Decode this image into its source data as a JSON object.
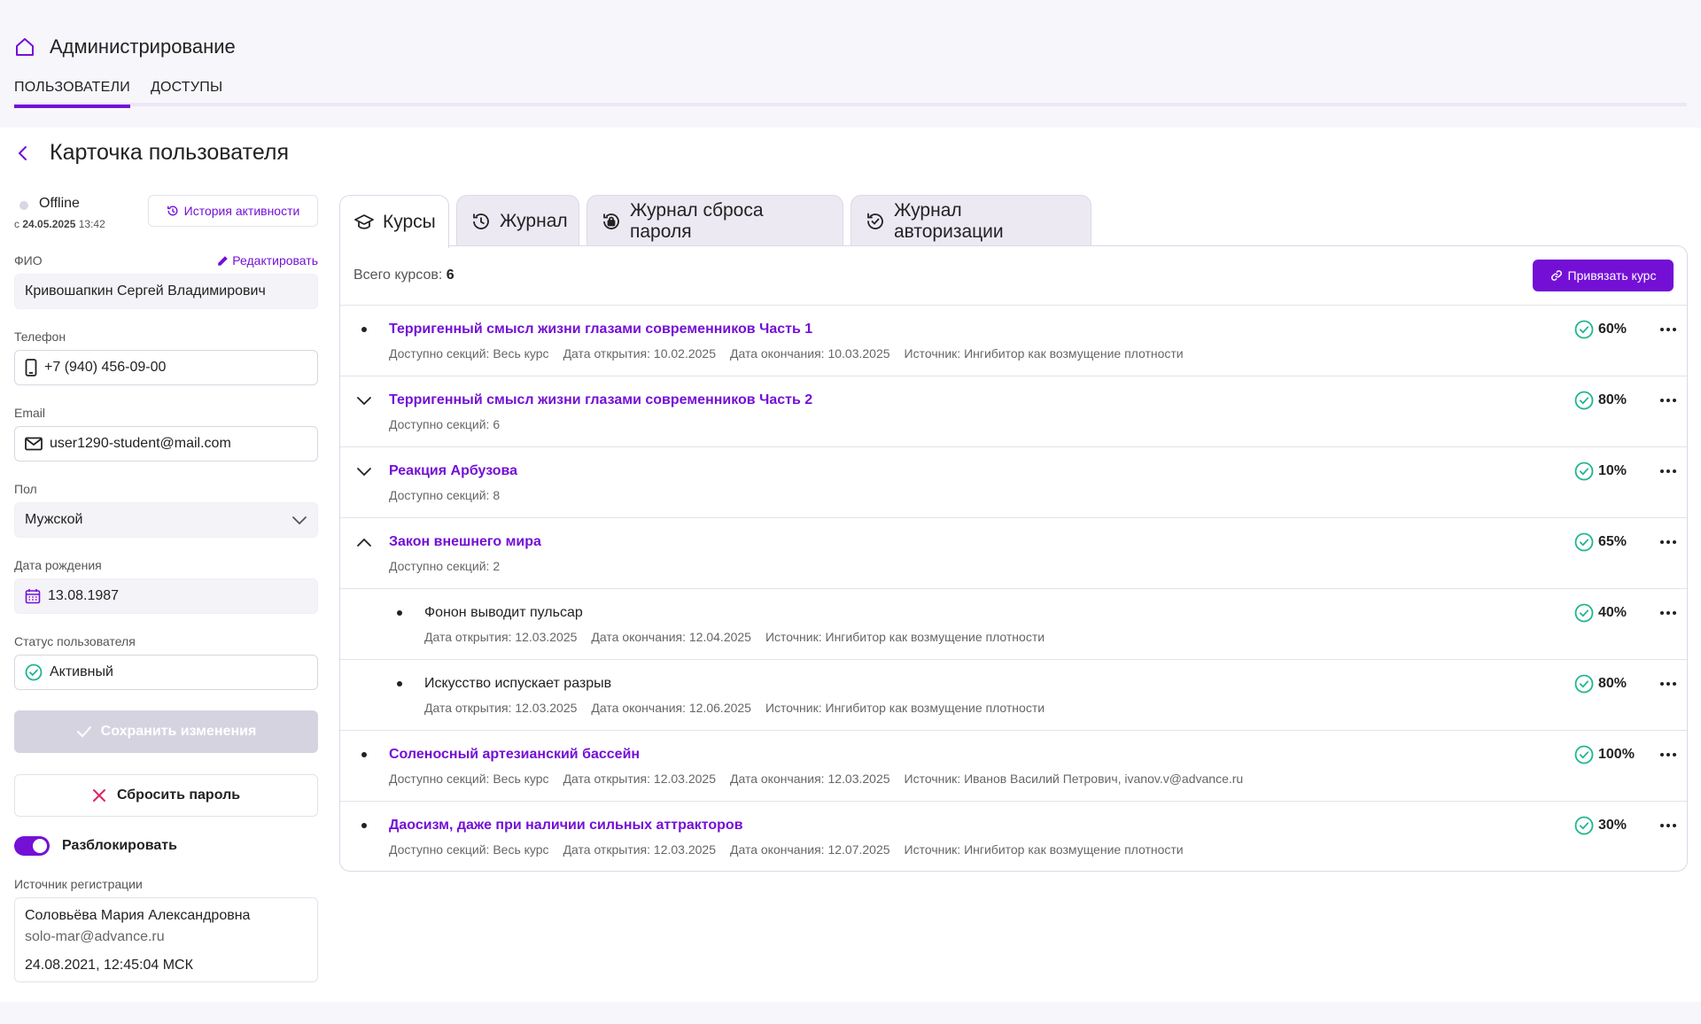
{
  "header": {
    "title": "Администрирование",
    "tabs": [
      {
        "label": "Пользователи",
        "active": true
      },
      {
        "label": "Доступы",
        "active": false
      }
    ]
  },
  "page": {
    "title": "Карточка пользователя"
  },
  "profile": {
    "status": "Offline",
    "status_since_prefix": "с",
    "status_since_date": "24.05.2025",
    "status_since_time": "13:42",
    "history_button": "История активности",
    "edit_link": "Редактировать",
    "fields": {
      "fio": {
        "label": "ФИО",
        "value": "Кривошапкин Сергей Владимирович"
      },
      "phone": {
        "label": "Телефон",
        "value": "+7 (940) 456-09-00"
      },
      "email": {
        "label": "Email",
        "value": "user1290-student@mail.com"
      },
      "gender": {
        "label": "Пол",
        "value": "Мужской"
      },
      "birth": {
        "label": "Дата рождения",
        "value": "13.08.1987"
      },
      "user_status": {
        "label": "Статус пользователя",
        "value": "Активный"
      }
    },
    "save_button": "Сохранить изменения",
    "reset_button": "Сбросить пароль",
    "unblock_label": "Разблокировать",
    "unblock_on": true,
    "reg_source": {
      "label": "Источник регистрации",
      "name": "Соловьёва Мария Александровна",
      "email": "solo-mar@advance.ru",
      "datetime": "24.08.2021, 12:45:04 МСК"
    }
  },
  "content_tabs": [
    {
      "label": "Курсы",
      "icon": "graduation-cap-icon",
      "active": true
    },
    {
      "label": "Журнал",
      "icon": "history-icon",
      "active": false
    },
    {
      "label": "Журнал сброса пароля",
      "icon": "lock-reset-icon",
      "active": false
    },
    {
      "label": "Журнал авторизации",
      "icon": "auth-history-icon",
      "active": false
    }
  ],
  "courses": {
    "total_label": "Всего курсов:",
    "total": "6",
    "bind_button": "Привязать курс",
    "rows": [
      {
        "lead": "bullet",
        "title": "Терригенный смысл жизни глазами современников Часть 1",
        "meta": [
          "Доступно секций: Весь курс",
          "Дата открытия: 10.02.2025",
          "Дата окончания: 10.03.2025",
          "Источник: Ингибитор как возмущение плотности"
        ],
        "pct": "60%"
      },
      {
        "lead": "chevron-down",
        "title": "Терригенный смысл жизни глазами современников Часть 2",
        "meta": [
          "Доступно секций:  6"
        ],
        "pct": "80%"
      },
      {
        "lead": "chevron-down",
        "title": "Реакция Арбузова",
        "meta": [
          "Доступно секций: 8"
        ],
        "pct": "10%"
      },
      {
        "lead": "chevron-up",
        "title": "Закон внешнего мира",
        "meta": [
          "Доступно секций: 2"
        ],
        "pct": "65%"
      },
      {
        "lead": "bullet",
        "child": true,
        "title": "Фонон выводит пульсар",
        "meta": [
          "Дата открытия: 12.03.2025",
          "Дата окончания: 12.04.2025",
          "Источник: Ингибитор как возмущение плотности"
        ],
        "pct": "40%"
      },
      {
        "lead": "bullet",
        "child": true,
        "title": "Искусство испускает разрыв",
        "meta": [
          "Дата открытия: 12.03.2025",
          "Дата окончания: 12.06.2025",
          "Источник: Ингибитор как возмущение плотности"
        ],
        "pct": "80%"
      },
      {
        "lead": "bullet",
        "title": "Соленосный артезианский бассейн",
        "meta": [
          "Доступно секций: Весь курс",
          "Дата открытия: 12.03.2025",
          "Дата окончания: 12.03.2025",
          "Источник: Иванов Василий Петрович, ivanov.v@advance.ru"
        ],
        "pct": "100%"
      },
      {
        "lead": "bullet",
        "title": "Даосизм, даже при наличии сильных аттракторов",
        "meta": [
          "Доступно секций: Весь курс",
          "Дата открытия: 12.03.2025",
          "Дата окончания: 12.07.2025",
          "Источник: Ингибитор как возмущение плотности"
        ],
        "pct": "30%"
      }
    ]
  },
  "colors": {
    "accent": "#7410d6",
    "success": "#1fb58f",
    "disabled": "#d6d3e1",
    "danger": "#e0245e"
  }
}
